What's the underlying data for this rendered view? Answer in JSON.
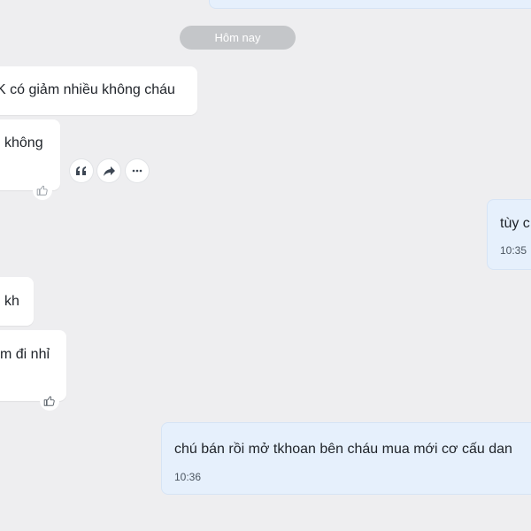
{
  "date_separator": "Hôm nay",
  "messages": [
    {
      "direction": "incoming",
      "text": "K có giảm nhiều không cháu"
    },
    {
      "direction": "incoming",
      "text": "không"
    },
    {
      "direction": "outgoing",
      "text": "tùy c",
      "time": "10:35"
    },
    {
      "direction": "incoming",
      "text": "kh"
    },
    {
      "direction": "incoming",
      "text": "m đi nhỉ"
    },
    {
      "direction": "outgoing",
      "text": "chú bán rồi mở tkhoan bên cháu mua mới cơ cấu dan",
      "time": "10:36"
    }
  ],
  "icons": {
    "quote": "quote-icon",
    "forward": "forward-icon",
    "more": "more-icon",
    "like": "thumbs-up-icon"
  },
  "colors": {
    "background": "#eeeef0",
    "incoming_bubble": "#ffffff",
    "outgoing_bubble": "#e6f0fc",
    "date_pill": "#c4c6c9"
  }
}
